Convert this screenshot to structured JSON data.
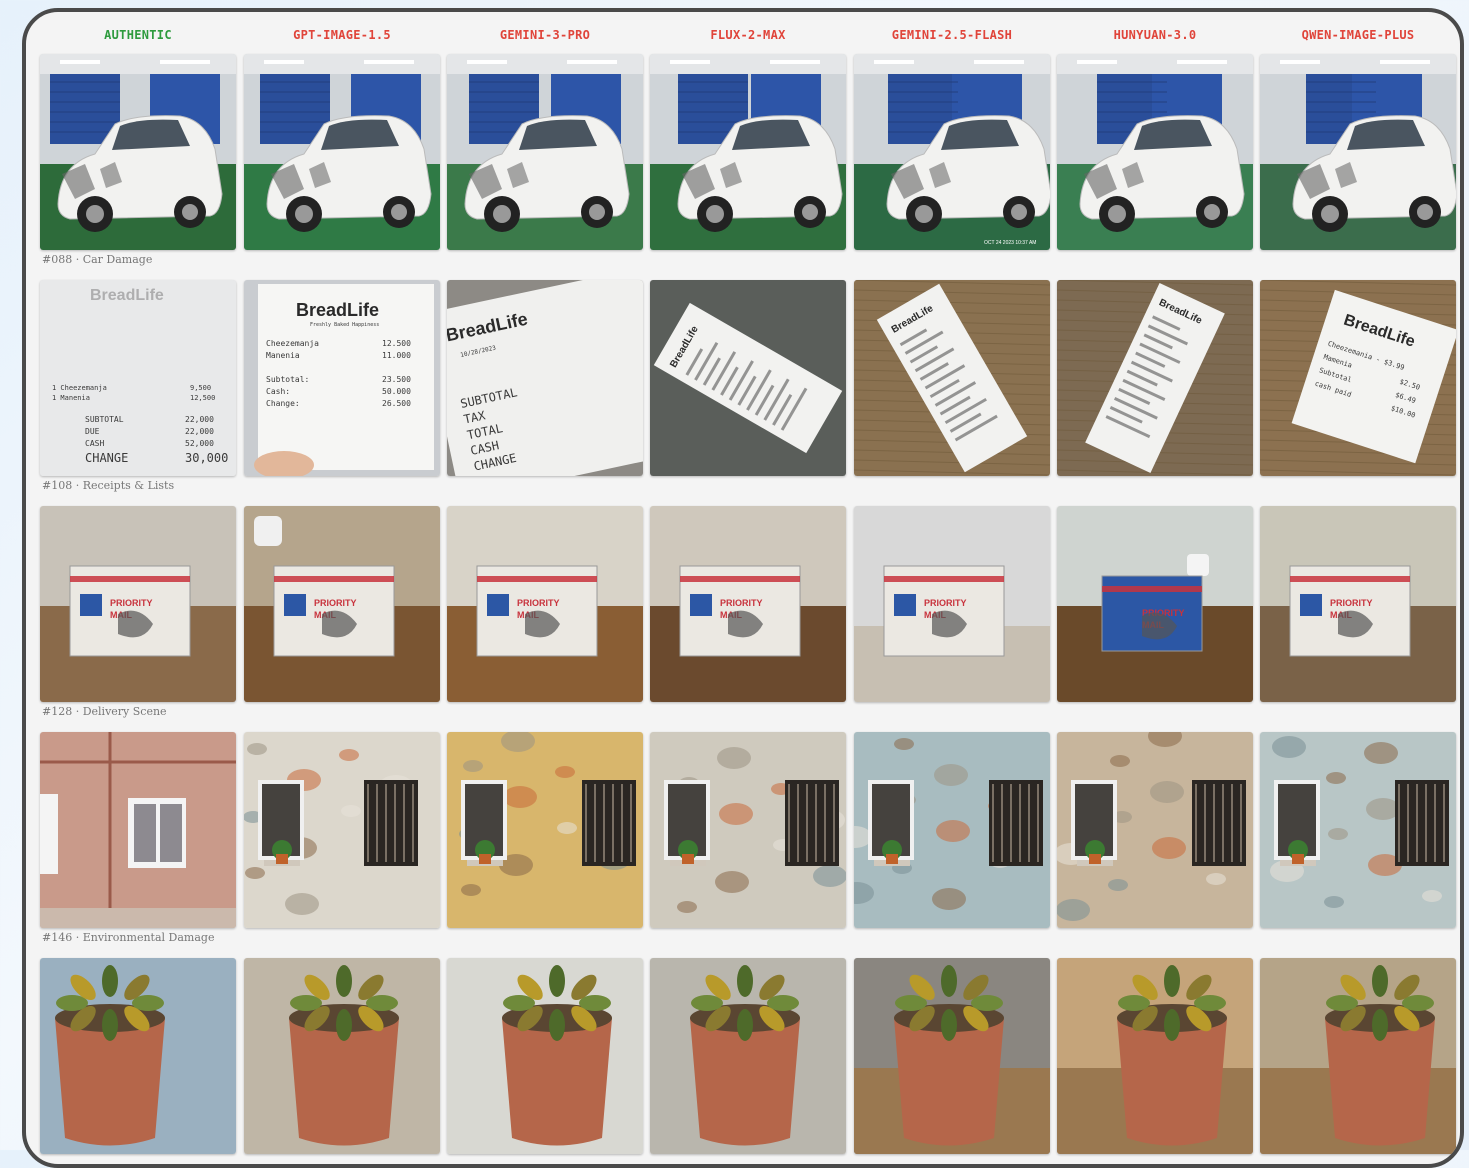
{
  "headers": [
    {
      "label": "AUTHENTIC",
      "color": "#2e9b3e"
    },
    {
      "label": "GPT-IMAGE-1.5",
      "color": "#e0443a"
    },
    {
      "label": "GEMINI-3-PRO",
      "color": "#e0443a"
    },
    {
      "label": "FLUX-2-MAX",
      "color": "#e0443a"
    },
    {
      "label": "GEMINI-2.5-FLASH",
      "color": "#e0443a"
    },
    {
      "label": "HUNYUAN-3.0",
      "color": "#e0443a"
    },
    {
      "label": "QWEN-IMAGE-PLUS",
      "color": "#e0443a"
    }
  ],
  "rows": [
    {
      "label": "#088 · Car Damage",
      "kind": "car"
    },
    {
      "label": "#108 · Receipts & Lists",
      "kind": "receipt"
    },
    {
      "label": "#128 · Delivery Scene",
      "kind": "box"
    },
    {
      "label": "#146 · Environmental Damage",
      "kind": "wall"
    },
    {
      "label": "",
      "kind": "plant"
    }
  ],
  "receipt_text": {
    "brand": "BreadLife",
    "tagline": "Freshly Baked Happiness",
    "item1": "Cheezemanja",
    "item1_price": "12.500",
    "item2": "Manenia",
    "item2_price": "11.000",
    "subtotal_label": "Subtotal:",
    "subtotal": "23.500",
    "cash_label": "Cash:",
    "cash": "50.000",
    "change_label": "Change:",
    "change": "26.500",
    "a_item1": "1 Cheezemanja",
    "a_item1_price": "9,500",
    "a_item2": "1 Manenia",
    "a_item2_price": "12,500",
    "a_subtotal": "SUBTOTAL",
    "a_due": "DUE",
    "a_cash": "CASH",
    "a_change": "CHANGE",
    "a_v1": "22,000",
    "a_v2": "22,000",
    "a_v3": "52,000",
    "a_v4": "30,000",
    "g_date": "10/28/2023",
    "g_subtotal": "SUBTOTAL",
    "g_tax": "TAX",
    "g_total": "TOTAL",
    "g_cash": "CASH",
    "g_change": "CHANGE",
    "q_item1": "Cheezemania - $3.99",
    "q_item2": "Mamenia",
    "q_p2": "$2.50",
    "q_sub": "Subtotal",
    "q_subv": "$6.49",
    "q_cash": "cash paid",
    "q_cashv": "$10.00"
  },
  "box_text": {
    "priority": "PRIORITY",
    "mail": "MAIL"
  },
  "car_timestamp": "OCT 24 2023 10:37 AM",
  "colors": {
    "header_green": "#2e9b3e",
    "header_red": "#e0443a",
    "frame": "#4a4a4a"
  }
}
